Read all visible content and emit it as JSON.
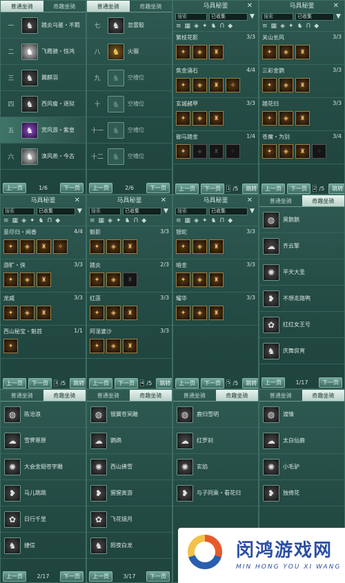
{
  "tabs": {
    "normal": "普通坐骑",
    "fun": "奇趣坐骑"
  },
  "page_buttons": {
    "prev": "上一页",
    "next": "下一页",
    "jump": "跳转"
  },
  "mount_panel_1": {
    "rows": [
      {
        "num": "一",
        "name": "踏炎乌骓・不羁"
      },
      {
        "num": "二",
        "name": "飞霞骢・惊鸿"
      },
      {
        "num": "三",
        "name": "翼麒羽"
      },
      {
        "num": "四",
        "name": "西风瘦・逐狱"
      },
      {
        "num": "五",
        "name": "赏风游・紫皇"
      },
      {
        "num": "六",
        "name": "涣风燕・今古"
      }
    ],
    "page": "1/6"
  },
  "mount_panel_2": {
    "rows": [
      {
        "num": "七",
        "name": "忽雷駮"
      },
      {
        "num": "八",
        "name": "火骝"
      },
      {
        "num": "九",
        "name": "空槽位"
      },
      {
        "num": "十",
        "name": "空槽位"
      },
      {
        "num": "十一",
        "name": "空槽位"
      },
      {
        "num": "十二",
        "name": "空槽位"
      }
    ],
    "page": "2/6"
  },
  "codex": {
    "title": "马具秘鉴",
    "search_placeholder": "搜索",
    "filter": "已收集",
    "icons": [
      "≡",
      "▦",
      "◈",
      "✦",
      "♞",
      "Ո",
      "◆"
    ]
  },
  "codex_panels": [
    {
      "groups": [
        {
          "name": "繁枝花影",
          "count": "3/3"
        },
        {
          "name": "焦金涌石",
          "count": "4/4"
        },
        {
          "name": "玄城赭甲",
          "count": "3/3"
        },
        {
          "name": "御马踏金",
          "count": "1/4"
        }
      ],
      "page": "1",
      "total": "/5"
    },
    {
      "groups": [
        {
          "name": "关山长风",
          "count": "3/3"
        },
        {
          "name": "三彩金鹦",
          "count": "3/3"
        },
        {
          "name": "踏花归",
          "count": "3/3"
        },
        {
          "name": "苍魔・为别",
          "count": "3/4"
        }
      ],
      "page": "2",
      "total": "/5"
    },
    {
      "groups": [
        {
          "name": "意尽归・闻香",
          "count": "4/4"
        },
        {
          "name": "游旷・侠",
          "count": "3/3"
        },
        {
          "name": "龙威",
          "count": "3/3"
        },
        {
          "name": "西山秘宝・魁首",
          "count": "1/1"
        }
      ],
      "page": "3",
      "total": "/5"
    },
    {
      "groups": [
        {
          "name": "魁影",
          "count": "3/3"
        },
        {
          "name": "踏炎",
          "count": "2/3"
        },
        {
          "name": "红莲",
          "count": "3/3"
        },
        {
          "name": "阿湿婆沙",
          "count": "3/3"
        }
      ],
      "page": "4",
      "total": "/5"
    },
    {
      "groups": [
        {
          "name": "银蛇",
          "count": "3/3"
        },
        {
          "name": "暗金",
          "count": "3/3"
        },
        {
          "name": "耀华",
          "count": "3/3"
        }
      ],
      "page": "5",
      "total": "/5"
    }
  ],
  "fun_panel_1": {
    "rows": [
      {
        "name": "黑鹅鹅"
      },
      {
        "name": "齐云擎"
      },
      {
        "name": "平天大圣"
      },
      {
        "name": "不想走路鸭"
      },
      {
        "name": "红红女王号"
      },
      {
        "name": "庆舞良宵"
      }
    ],
    "page": "1/17"
  },
  "fun_panel_2": {
    "rows": [
      {
        "name": "陈沧浪"
      },
      {
        "name": "雪霁寒原"
      },
      {
        "name": "大会金翅苍宇雕"
      },
      {
        "name": "马儿跳跳"
      },
      {
        "name": "日行千里"
      },
      {
        "name": "捷信"
      }
    ],
    "page": "2/17"
  },
  "fun_panel_3": {
    "rows": [
      {
        "name": "银翼苍冥雕"
      },
      {
        "name": "鹦鹉"
      },
      {
        "name": "西山拂雪"
      },
      {
        "name": "猩猩寅游"
      },
      {
        "name": "飞花镜月"
      },
      {
        "name": "照夜白龙"
      }
    ],
    "page": "3/17"
  },
  "fun_panel_4": {
    "rows": [
      {
        "name": "鹿归雪明"
      },
      {
        "name": "红罗刹"
      },
      {
        "name": "玄焰"
      },
      {
        "name": "与子同乘・看花归"
      }
    ]
  },
  "fun_panel_5": {
    "rows": [
      {
        "name": "渡情"
      },
      {
        "name": "太白仙鹿"
      },
      {
        "name": "小毛驴"
      },
      {
        "name": "独倚花"
      }
    ]
  },
  "watermark": {
    "title": "闵鸿游戏网",
    "sub": "MIN HONG YOU XI WANG"
  }
}
